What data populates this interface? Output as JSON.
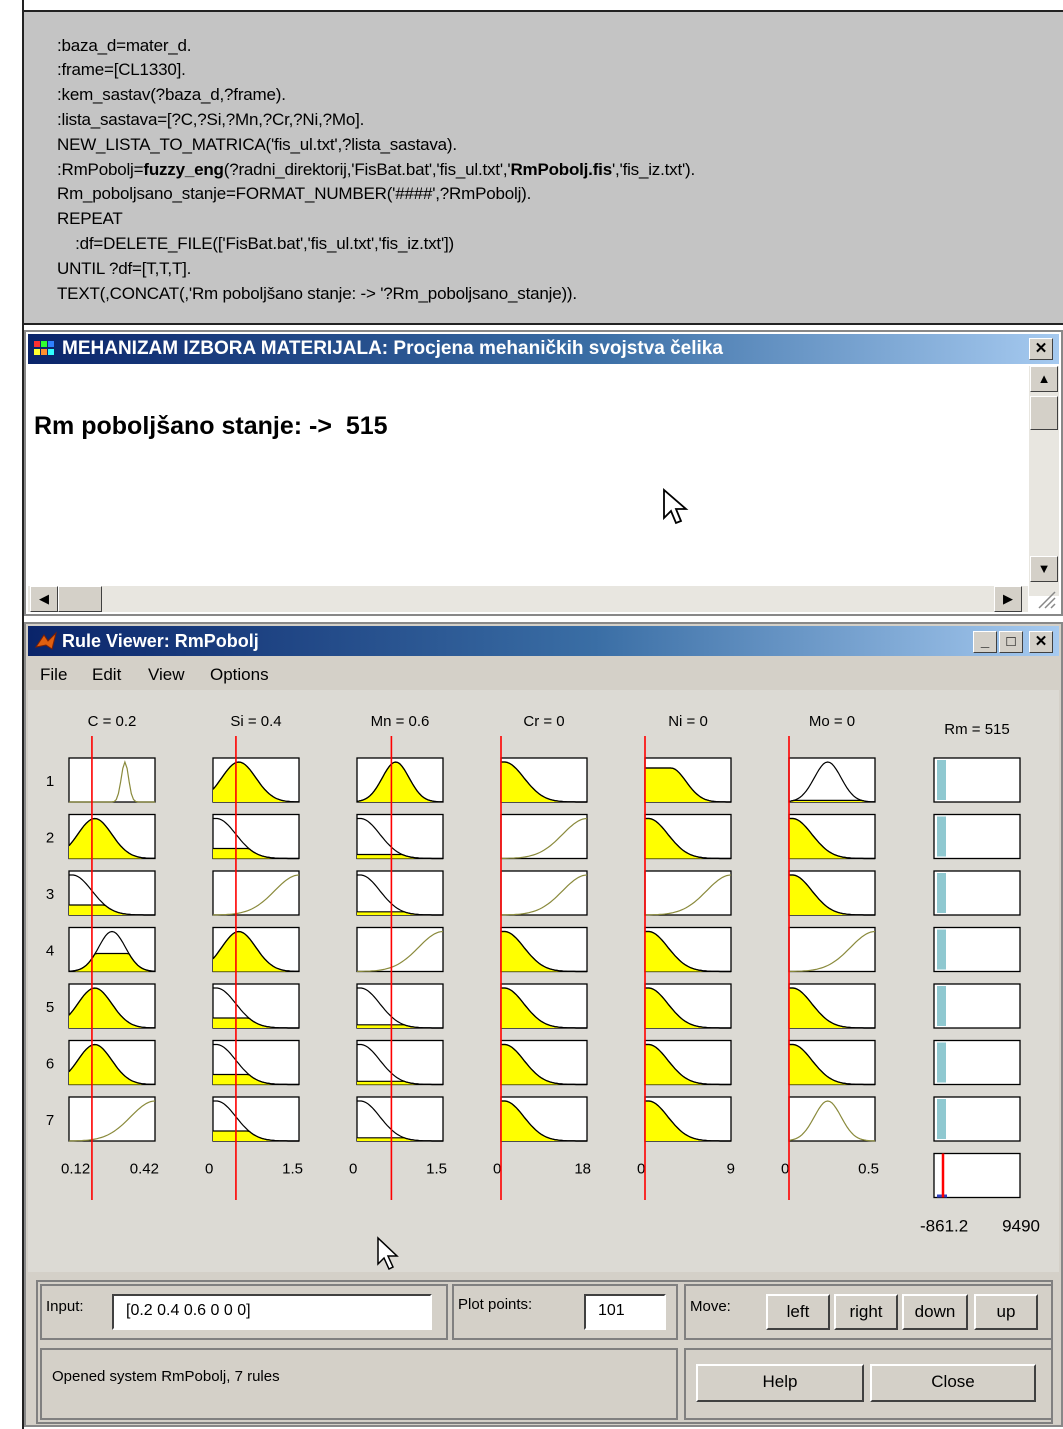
{
  "code": {
    "lines": [
      ":baza_d=mater_d.",
      ":frame=[CL1330].",
      ":kem_sastav(?baza_d,?frame).",
      ":lista_sastava=[?C,?Si,?Mn,?Cr,?Ni,?Mo].",
      "NEW_LISTA_TO_MATRICA('fis_ul.txt',?lista_sastava).",
      "REPEAT",
      "    :df=DELETE_FILE(['FisBat.bat','fis_ul.txt','fis_iz.txt'])",
      "UNTIL ?df=[T,T,T].",
      "TEXT(,CONCAT(,'Rm poboljšano stanje: -> '?Rm_poboljsano_stanje))."
    ],
    "fuzzy_line": {
      "pre": ":RmPobolj=",
      "bold1": "fuzzy_eng",
      "mid": "(?radni_direktorij,'FisBat.bat','fis_ul.txt','",
      "bold2": "RmPobolj.fis",
      "post": "','fis_iz.txt')."
    },
    "format_line": "Rm_poboljsano_stanje=FORMAT_NUMBER('####',?RmPobolj)."
  },
  "output_window": {
    "title": "MEHANIZAM IZBORA MATERIJALA: Procjena mehaničkih svojstva čelika",
    "close_label": "✕",
    "result_text": "Rm poboljšano stanje: ->  515"
  },
  "rule_viewer": {
    "title": "Rule Viewer: RmPobolj",
    "window_buttons": [
      "_",
      "□",
      "✕"
    ],
    "menu": [
      "File",
      "Edit",
      "View",
      "Options"
    ],
    "input_headers": [
      "C = 0.2",
      "Si = 0.4",
      "Mn = 0.6",
      "Cr = 0",
      "Ni = 0",
      "Mo = 0"
    ],
    "output_header": "Rm = 515",
    "rule_numbers": [
      "1",
      "2",
      "3",
      "4",
      "5",
      "6",
      "7"
    ],
    "axis_ranges": [
      {
        "min": "0.12",
        "max": "0.42"
      },
      {
        "min": "0",
        "max": "1.5"
      },
      {
        "min": "0",
        "max": "1.5"
      },
      {
        "min": "0",
        "max": "18"
      },
      {
        "min": "0",
        "max": "9"
      },
      {
        "min": "0",
        "max": "0.5"
      }
    ],
    "output_range": {
      "min": "-861.2",
      "max": "9490"
    },
    "input_values": [
      0.2,
      0.4,
      0.6,
      0,
      0,
      0
    ],
    "input_value_color": "#ff0000",
    "fill_color": "#ffff00",
    "mf_line_color": "#8a8a3c",
    "output_bar_color": "#8fc8d0",
    "input_label": "Input:",
    "input_value": "[0.2 0.4 0.6 0 0 0]",
    "plot_points_label": "Plot points:",
    "plot_points_value": "101",
    "move_label": "Move:",
    "move_buttons": [
      "left",
      "right",
      "down",
      "up"
    ],
    "status_text": "Opened system RmPobolj, 7 rules",
    "help_label": "Help",
    "close_label": "Close"
  }
}
